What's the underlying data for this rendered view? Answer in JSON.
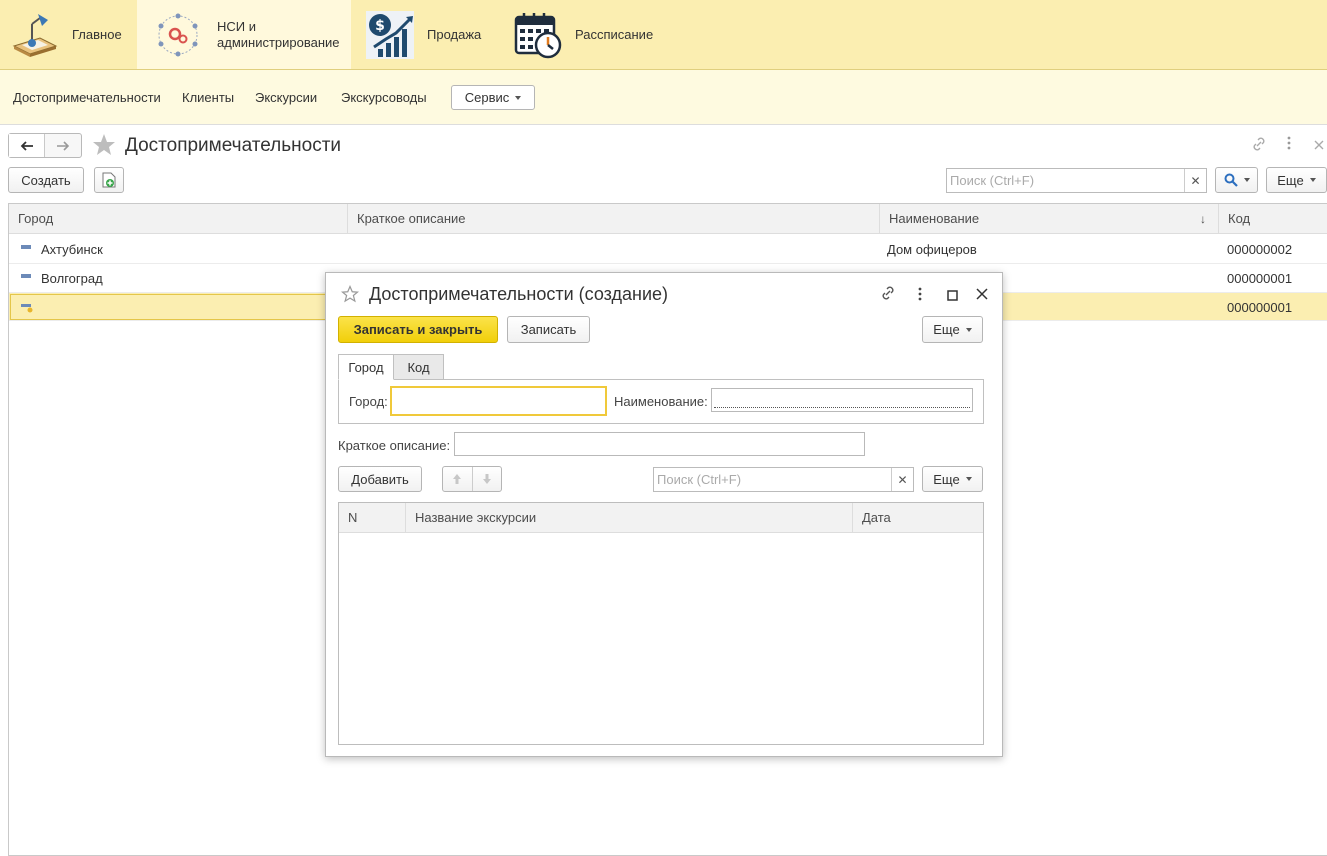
{
  "sections": [
    {
      "label": "Главное",
      "icon": "desk-lamp-icon"
    },
    {
      "label": "НСИ и администрирование",
      "label_line1": "НСИ и",
      "label_line2": "администрирование",
      "icon": "settings-network-icon"
    },
    {
      "label": "Продажа",
      "icon": "sales-chart-icon"
    },
    {
      "label": "Рассписание",
      "icon": "calendar-clock-icon"
    }
  ],
  "submenu": {
    "items": [
      "Достопримечательности",
      "Клиенты",
      "Экскурсии",
      "Экскурсоводы"
    ],
    "service_label": "Сервис"
  },
  "page": {
    "title": "Достопримечательности",
    "create_label": "Создать",
    "search_placeholder": "Поиск (Ctrl+F)",
    "more_label": "Еще"
  },
  "list": {
    "columns": [
      "Город",
      "Краткое описание",
      "Наименование",
      "Код"
    ],
    "rows": [
      {
        "city": "Ахтубинск",
        "desc": "",
        "name": "Дом офицеров",
        "code": "000000002"
      },
      {
        "city": "Волгоград",
        "desc": "",
        "name": "",
        "code": "000000001"
      },
      {
        "city": "",
        "desc": "",
        "name": "",
        "code": "000000001"
      }
    ]
  },
  "dialog": {
    "title": "Достопримечательности (создание)",
    "save_close_label": "Записать и закрыть",
    "save_label": "Записать",
    "more_label": "Еще",
    "tabs": [
      "Город",
      "Код"
    ],
    "city_label": "Город:",
    "city_value": "",
    "name_label": "Наименование:",
    "name_value": "",
    "desc_label": "Краткое описание:",
    "desc_value": "",
    "add_label": "Добавить",
    "search_placeholder": "Поиск (Ctrl+F)",
    "grid_columns": [
      "N",
      "Название экскурсии",
      "Дата"
    ]
  },
  "colors": {
    "section_bar": "#fbeeb1",
    "submenu_bg": "#fefae0",
    "primary_button": "#f5d90d",
    "selected_row": "#fbeeb1"
  }
}
